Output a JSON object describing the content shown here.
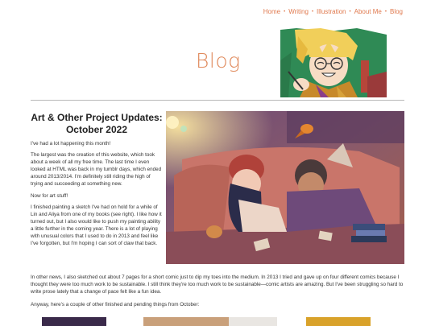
{
  "nav": {
    "items": [
      "Home",
      "Writing",
      "Illustration",
      "About Me",
      "Blog"
    ]
  },
  "header": {
    "title": "Blog"
  },
  "post": {
    "title": "Art & Other Project Updates: October 2022",
    "column_paragraphs": [
      "I've had a lot happening this month!",
      "The largest was the creation of this website, which took about a week of all my free time. The last time I even looked at HTML was back in my tumblr days, which ended around 2013/2014. I'm definitely still riding the high of trying and succeeding at something new.",
      "Now for art stuff!",
      "I finished painting a sketch I've had on hold for a while of Lin and Aliya from one of my books (see right). I like how it turned out, but I also would like to push my painting ability a little further in the coming year. There is a lot of playing with unusual colors that I used to do in 2013 and feel like I've forgotten, but I'm hoping I can sort of claw that back."
    ],
    "full_paragraph_1": "In other news, I also sketched out about 7 pages for a short comic just to dip my toes into the medium. In 2013 I tried and gave up on four different comics because I thought they were too much work to be sustainable. I still think they're too much work to be sustainable—comic artists are amazing. But I've been struggling so hard to write prose lately that a change of pace felt like a fun idea.",
    "full_paragraph_2": "Anyway, here's a couple of other finished and pending things from October:"
  },
  "colors": {
    "accent": "#e07a4f",
    "title": "#e08a5c",
    "rule": "#b9b9b9"
  }
}
